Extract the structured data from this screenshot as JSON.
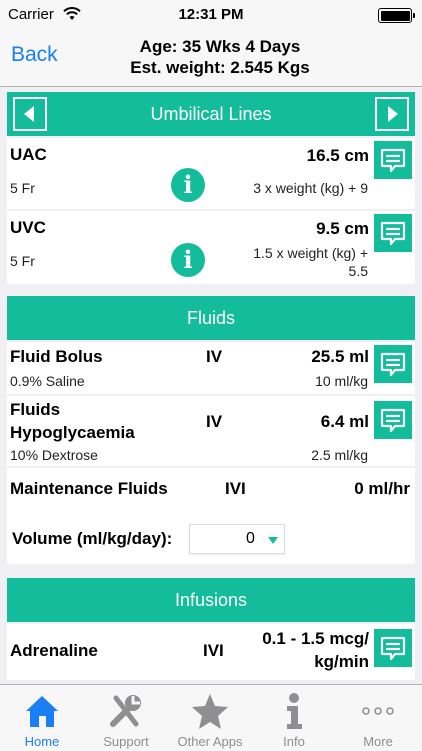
{
  "status": {
    "carrier": "Carrier",
    "time": "12:31 PM"
  },
  "nav": {
    "back_label": "Back",
    "age": "Age: 35 Wks 4 Days",
    "weight": "Est. weight: 2.545 Kgs"
  },
  "umbilical": {
    "title": "Umbilical Lines",
    "uac": {
      "name": "UAC",
      "size": "5 Fr",
      "value": "16.5 cm",
      "formula": "3 x weight (kg) + 9"
    },
    "uvc": {
      "name": "UVC",
      "size": "5 Fr",
      "value": "9.5 cm",
      "formula_1": "1.5 x weight (kg) +",
      "formula_2": "5.5"
    }
  },
  "fluids": {
    "title": "Fluids",
    "bolus": {
      "name": "Fluid Bolus",
      "route": "IV",
      "value": "25.5 ml",
      "detail": "0.9% Saline",
      "dose": "10 ml/kg"
    },
    "hypo": {
      "name_1": "Fluids",
      "name_2": "Hypoglycaemia",
      "route": "IV",
      "value": "6.4 ml",
      "detail": "10% Dextrose",
      "dose": "2.5 ml/kg"
    },
    "maintenance": {
      "name": "Maintenance Fluids",
      "route": "IVI",
      "value": "0 ml/hr"
    },
    "volume": {
      "label": "Volume (ml/kg/day):",
      "selected": "0"
    }
  },
  "infusions": {
    "title": "Infusions",
    "adrenaline": {
      "name": "Adrenaline",
      "route": "IVI",
      "value_1": "0.1 - 1.5 mcg/",
      "value_2": "kg/min"
    }
  },
  "tabs": [
    {
      "label": "Home"
    },
    {
      "label": "Support"
    },
    {
      "label": "Other Apps"
    },
    {
      "label": "Info"
    },
    {
      "label": "More"
    }
  ],
  "colors": {
    "accent": "#13bc9a",
    "link": "#1a7ef5",
    "inactive": "#8e8e93"
  }
}
